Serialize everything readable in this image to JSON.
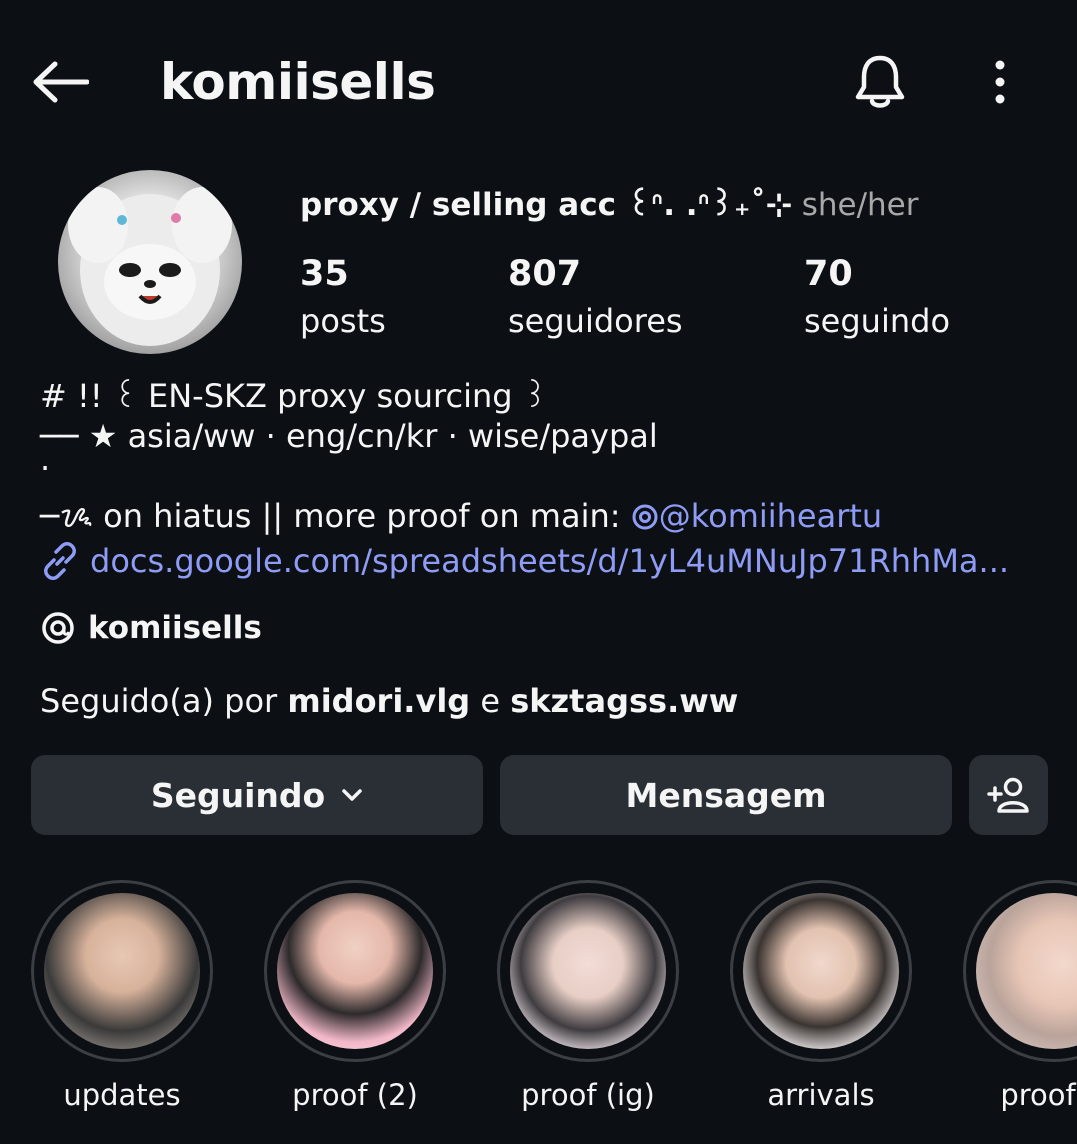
{
  "header": {
    "username": "komiisells",
    "back_icon": "arrow-left-icon",
    "bell_icon": "bell-icon",
    "more_icon": "more-vertical-icon"
  },
  "profile": {
    "display_name": "proxy / selling acc ꒰ᐢ. .ᐢ꒱₊˚⊹",
    "pronouns": "she/her",
    "stats": [
      {
        "value": "35",
        "label": "posts"
      },
      {
        "value": "807",
        "label": "seguidores"
      },
      {
        "value": "70",
        "label": "seguindo"
      }
    ],
    "bio": {
      "line1": "# !! ꒰ EN-SKZ proxy sourcing ꒱",
      "line2": "── ★ asia/ww  ·  eng/cn/kr  ·  wise/paypal",
      "line3": "·",
      "line4_text": "─ᝰ on hiatus || more proof on main: ",
      "line4_mention": "@komiiheartu",
      "link": "docs.google.com/spreadsheets/d/1yL4uMNuJp71RhhMa..."
    },
    "threads_handle": "komiisells",
    "followed_by": {
      "prefix": "Seguido(a) por ",
      "user1": "midori.vlg",
      "conj": " e ",
      "user2": "skztagss.ww"
    }
  },
  "actions": {
    "following_label": "Seguindo",
    "message_label": "Mensagem",
    "add_person_icon": "add-person-icon"
  },
  "highlights": [
    {
      "label": "updates"
    },
    {
      "label": "proof (2)"
    },
    {
      "label": "proof (ig)"
    },
    {
      "label": "arrivals"
    },
    {
      "label": "proof (t"
    }
  ],
  "colors": {
    "background": "#0c1014",
    "button": "#2a2f36",
    "link": "#8e9cf5",
    "secondary_text": "#a8a8a8"
  }
}
